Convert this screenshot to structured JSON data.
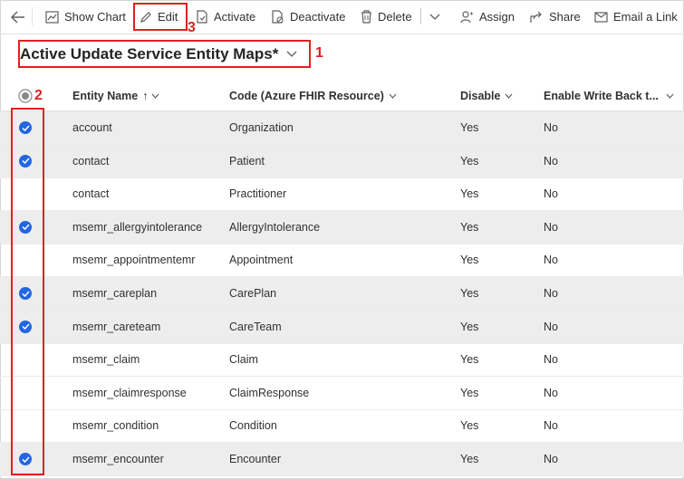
{
  "toolbar": {
    "back_icon": "back-arrow-icon",
    "items": [
      {
        "label": "Show Chart",
        "icon": "chart-icon"
      },
      {
        "label": "Edit",
        "icon": "pencil-icon"
      },
      {
        "label": "Activate",
        "icon": "activate-icon"
      },
      {
        "label": "Deactivate",
        "icon": "deactivate-icon"
      },
      {
        "label": "Delete",
        "icon": "trash-icon"
      },
      {
        "label": "Assign",
        "icon": "person-icon"
      },
      {
        "label": "Share",
        "icon": "share-icon"
      },
      {
        "label": "Email a Link",
        "icon": "email-icon"
      }
    ]
  },
  "view": {
    "title": "Active Update Service Entity Maps*",
    "chevron_icon": "chevron-down-icon"
  },
  "grid": {
    "columns": [
      {
        "label": "Entity Name",
        "sort": "↑"
      },
      {
        "label": "Code (Azure FHIR Resource)"
      },
      {
        "label": "Disable"
      },
      {
        "label": "Enable Write Back t..."
      }
    ],
    "rows": [
      {
        "selected": true,
        "entity": "account",
        "code": "Organization",
        "disable": "Yes",
        "write_back": "No"
      },
      {
        "selected": true,
        "entity": "contact",
        "code": "Patient",
        "disable": "Yes",
        "write_back": "No"
      },
      {
        "selected": false,
        "entity": "contact",
        "code": "Practitioner",
        "disable": "Yes",
        "write_back": "No"
      },
      {
        "selected": true,
        "entity": "msemr_allergyintolerance",
        "code": "AllergyIntolerance",
        "disable": "Yes",
        "write_back": "No"
      },
      {
        "selected": false,
        "entity": "msemr_appointmentemr",
        "code": "Appointment",
        "disable": "Yes",
        "write_back": "No"
      },
      {
        "selected": true,
        "entity": "msemr_careplan",
        "code": "CarePlan",
        "disable": "Yes",
        "write_back": "No"
      },
      {
        "selected": true,
        "entity": "msemr_careteam",
        "code": "CareTeam",
        "disable": "Yes",
        "write_back": "No"
      },
      {
        "selected": false,
        "entity": "msemr_claim",
        "code": "Claim",
        "disable": "Yes",
        "write_back": "No"
      },
      {
        "selected": false,
        "entity": "msemr_claimresponse",
        "code": "ClaimResponse",
        "disable": "Yes",
        "write_back": "No"
      },
      {
        "selected": false,
        "entity": "msemr_condition",
        "code": "Condition",
        "disable": "Yes",
        "write_back": "No"
      },
      {
        "selected": true,
        "entity": "msemr_encounter",
        "code": "Encounter",
        "disable": "Yes",
        "write_back": "No"
      }
    ]
  },
  "annotations": [
    "1",
    "2",
    "3"
  ],
  "colors": {
    "accent": "#2266e3",
    "annotation": "#e02020",
    "selected_row": "#ededed"
  }
}
